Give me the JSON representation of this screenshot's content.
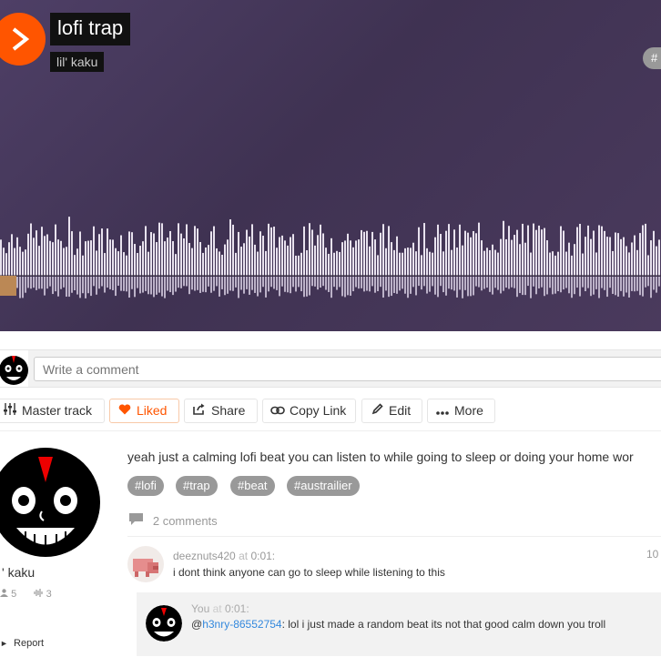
{
  "track": {
    "title": "lofi trap",
    "artist": "lil' kaku",
    "top_tag": "#"
  },
  "comment_box": {
    "placeholder": "Write a comment"
  },
  "actions": {
    "master": "Master track",
    "liked": "Liked",
    "share": "Share",
    "copy_link": "Copy Link",
    "edit": "Edit",
    "more": "More"
  },
  "colors": {
    "accent": "#ff5500",
    "tag_bg": "#999999",
    "hero_bg": "#45385a"
  },
  "uploader": {
    "name": "' kaku",
    "followers": "5",
    "tracks": "3",
    "report": "Report"
  },
  "description": "yeah just a calming lofi beat you can listen to while going to sleep or doing your home wor",
  "tags": [
    "#lofi",
    "#trap",
    "#beat",
    "#austrailier"
  ],
  "comments_count": "2 comments",
  "comments": [
    {
      "user": "deeznuts420",
      "at_word": "at",
      "position": "0:01",
      "text": "i dont think anyone can go to sleep while listening to this",
      "time": "10"
    }
  ],
  "reply": {
    "user": "You",
    "at_word": "at",
    "position": "0:01",
    "mention": "h3nry-86552754",
    "text": ": lol i just made a random beat its not that good calm down you troll",
    "time": ""
  }
}
